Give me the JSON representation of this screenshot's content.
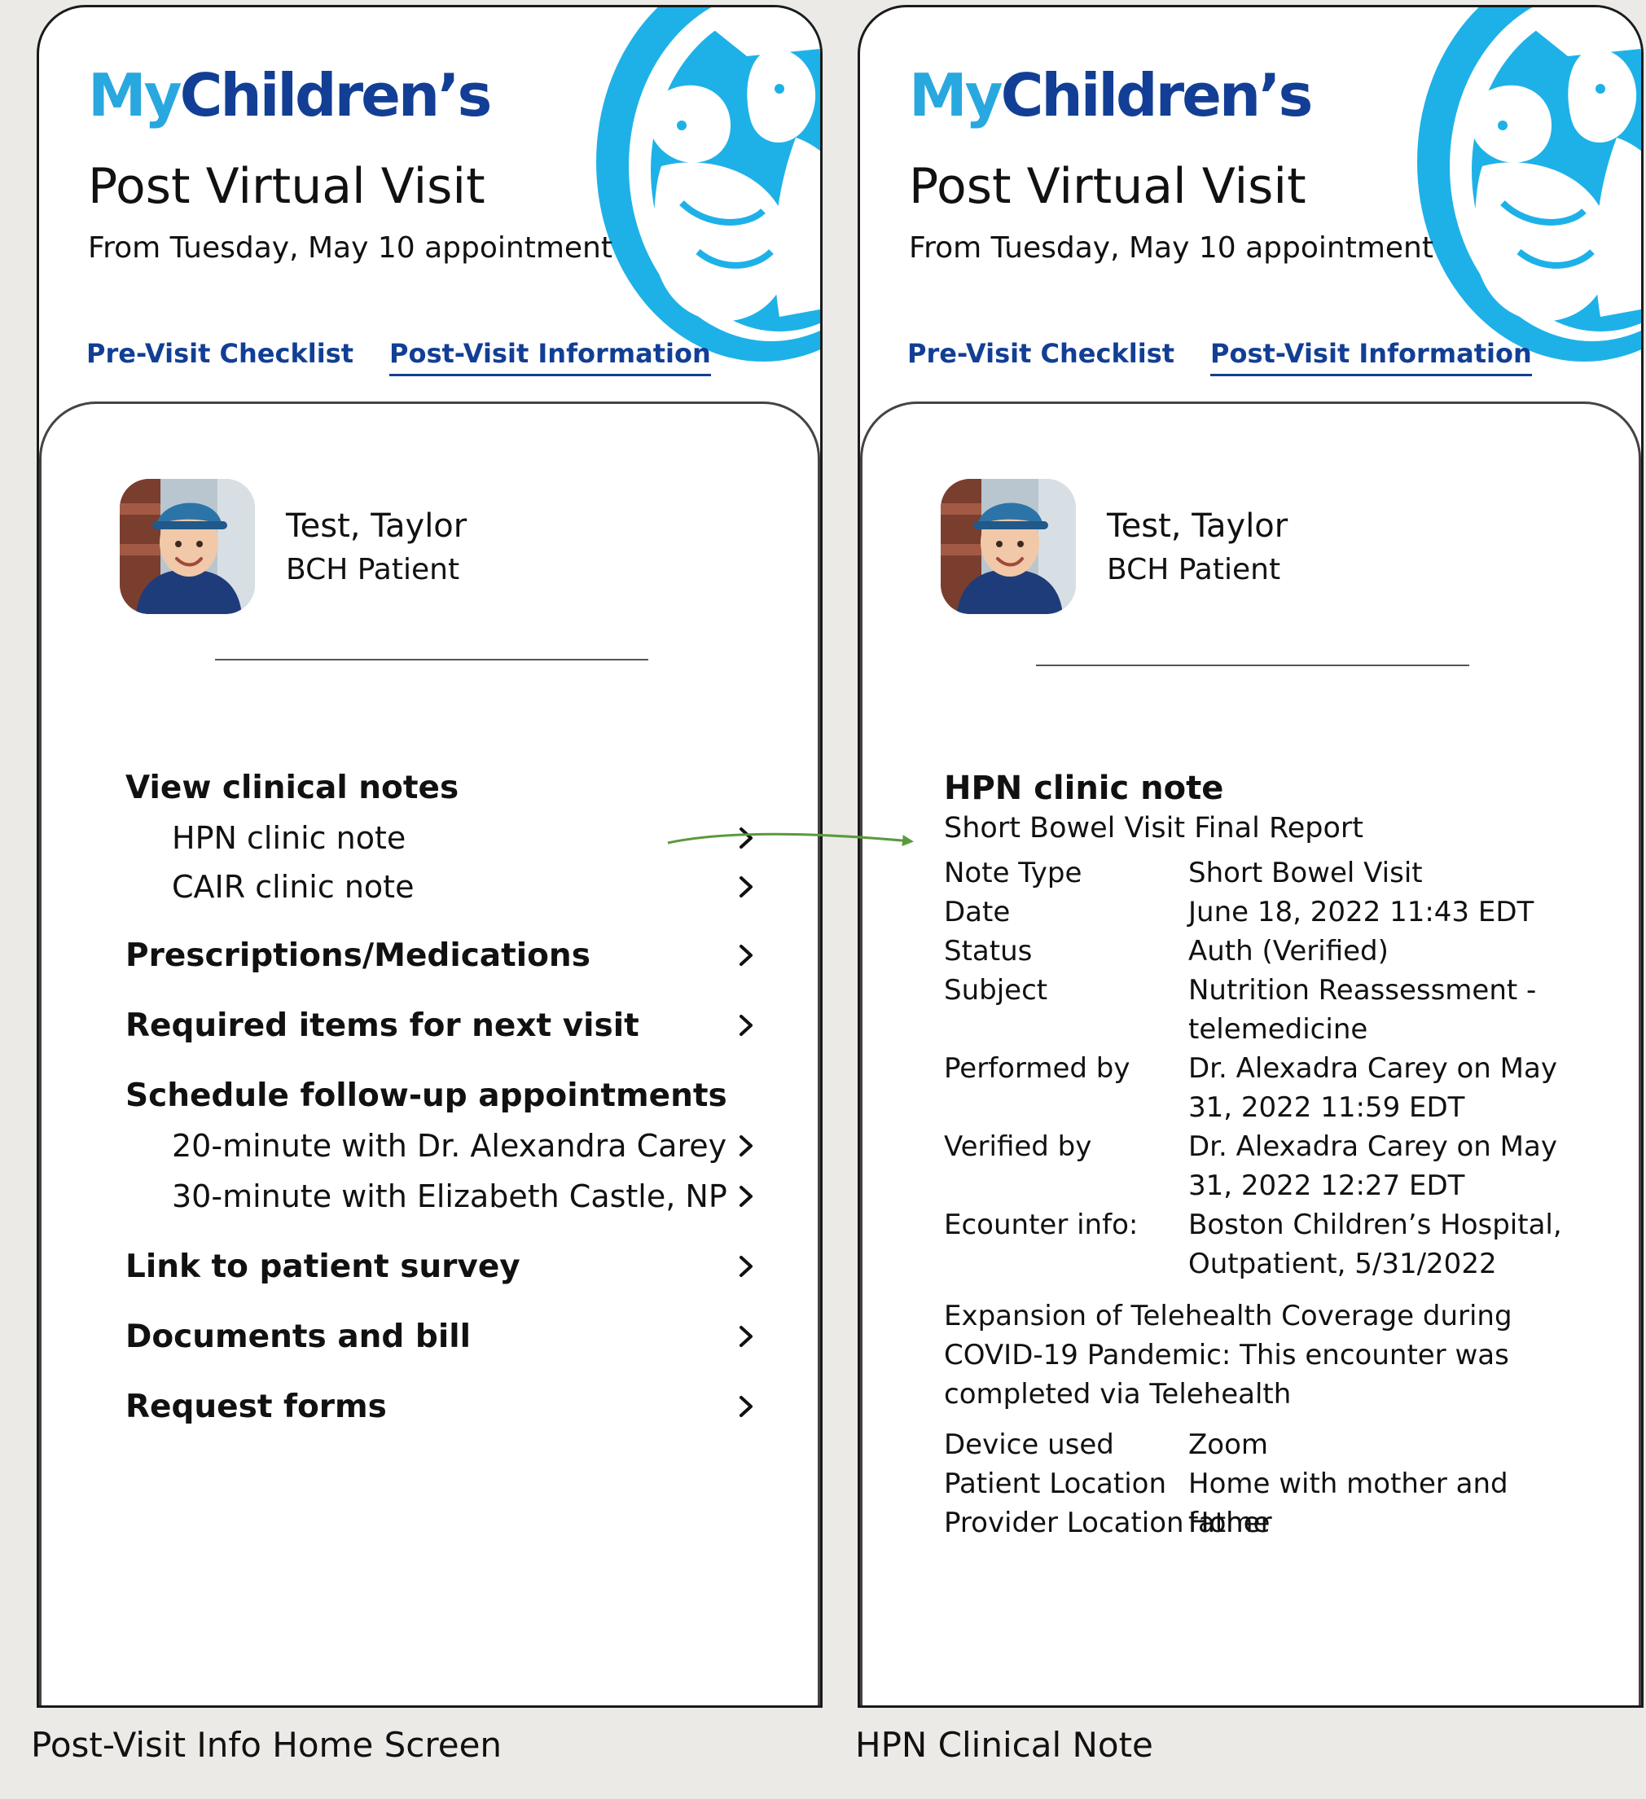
{
  "brand": {
    "my": "My",
    "childrens": "Children’s"
  },
  "header": {
    "title": "Post Virtual Visit",
    "subtitle": "From Tuesday, May 10 appointment",
    "tabs": [
      {
        "label": "Pre-Visit Checklist",
        "active": false
      },
      {
        "label": "Post-Visit Information",
        "active": true
      }
    ]
  },
  "patient": {
    "name": "Test, Taylor",
    "type": "BCH Patient"
  },
  "home_menu": {
    "view_notes": "View clinical notes",
    "note_items": [
      "HPN clinic note",
      "CAIR clinic note"
    ],
    "prescriptions": "Prescriptions/Medications",
    "required_items": "Required  items for next visit",
    "schedule": "Schedule follow-up appointments",
    "schedule_items": [
      "20-minute with Dr. Alexandra Carey",
      "30-minute with Elizabeth Castle, NP"
    ],
    "survey": "Link to patient survey",
    "documents": "Documents and bill",
    "forms": "Request forms"
  },
  "clinical_note": {
    "title": "HPN clinic note",
    "subtitle": "Short Bowel Visit Final Report",
    "fields": [
      {
        "key": "Note Type",
        "value": "Short Bowel Visit"
      },
      {
        "key": "Date",
        "value": "June 18, 2022 11:43 EDT"
      },
      {
        "key": "Status",
        "value": "Auth (Verified)"
      },
      {
        "key": "Subject",
        "value": "Nutrition Reassessment - telemedicine"
      },
      {
        "key": "Performed by",
        "value": "Dr. Alexadra Carey on May 31, 2022  11:59 EDT"
      },
      {
        "key": "Verified by",
        "value": "Dr. Alexadra Carey on May 31, 2022  12:27 EDT"
      },
      {
        "key": "Ecounter info:",
        "value": "Boston Children’s Hospital, Outpatient, 5/31/2022"
      }
    ],
    "paragraph": "Expansion of Telehealth Coverage during COVID-19 Pandemic: This encounter was completed via Telehealth",
    "device_fields": [
      {
        "key": "Device used",
        "value": "Zoom"
      },
      {
        "key": "Patient Location",
        "value": "Home with mother and father"
      },
      {
        "key": "Provider Location",
        "value": "Home"
      }
    ]
  },
  "captions": {
    "left": "Post-Visit Info Home Screen",
    "right": "HPN Clinical Note"
  },
  "colors": {
    "brand_light": "#29a8df",
    "brand_dark": "#123f95",
    "arrow": "#5a9a3c"
  }
}
